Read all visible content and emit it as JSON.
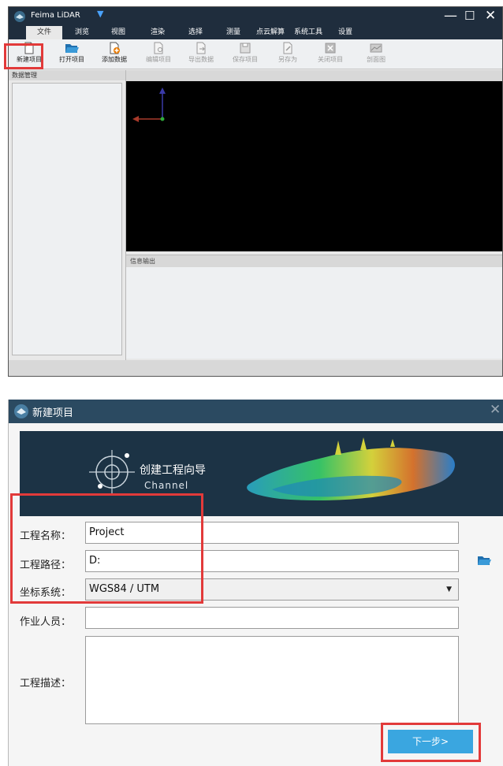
{
  "app": {
    "title": "Feima LiDAR",
    "dropdown_glyph": "▼",
    "window_controls": {
      "minimize": "—",
      "maximize": "☐",
      "close": "✕"
    }
  },
  "menu": {
    "items": [
      "文件",
      "浏览",
      "视图",
      "渲染",
      "选择",
      "测量",
      "点云解算",
      "系统工具",
      "设置"
    ],
    "active": "文件"
  },
  "toolbar": {
    "items": [
      {
        "label": "新建项目",
        "icon": "new-file-icon",
        "enabled": true
      },
      {
        "label": "打开项目",
        "icon": "open-folder-icon",
        "enabled": true
      },
      {
        "label": "添加数据",
        "icon": "add-data-icon",
        "enabled": true
      },
      {
        "label": "编辑项目",
        "icon": "edit-file-icon",
        "enabled": false
      },
      {
        "label": "导出数据",
        "icon": "export-icon",
        "enabled": false
      },
      {
        "label": "保存项目",
        "icon": "save-icon",
        "enabled": false
      },
      {
        "label": "另存为",
        "icon": "save-as-icon",
        "enabled": false
      },
      {
        "label": "关闭项目",
        "icon": "close-file-icon",
        "enabled": false
      },
      {
        "label": "剖面图",
        "icon": "profile-icon",
        "enabled": false
      }
    ]
  },
  "panels": {
    "data_management_title": "数据管理",
    "info_output_title": "信息输出"
  },
  "dialog": {
    "title": "新建项目",
    "close_glyph": "✕",
    "banner_title": "创建工程向导",
    "banner_subtitle": "Channel",
    "fields": {
      "name_label": "工程名称：",
      "name_value": "Project",
      "path_label": "工程路径：",
      "path_value": "D:",
      "crs_label": "坐标系统：",
      "crs_value": "WGS84 / UTM",
      "operator_label": "作业人员：",
      "operator_value": "",
      "description_label": "工程描述：",
      "description_value": ""
    },
    "next_button": "下一步>"
  },
  "colors": {
    "titlebar": "#1f2d3d",
    "dialog_titlebar": "#2b4a61",
    "highlight": "#e23a3a",
    "button": "#3aa6e0"
  }
}
